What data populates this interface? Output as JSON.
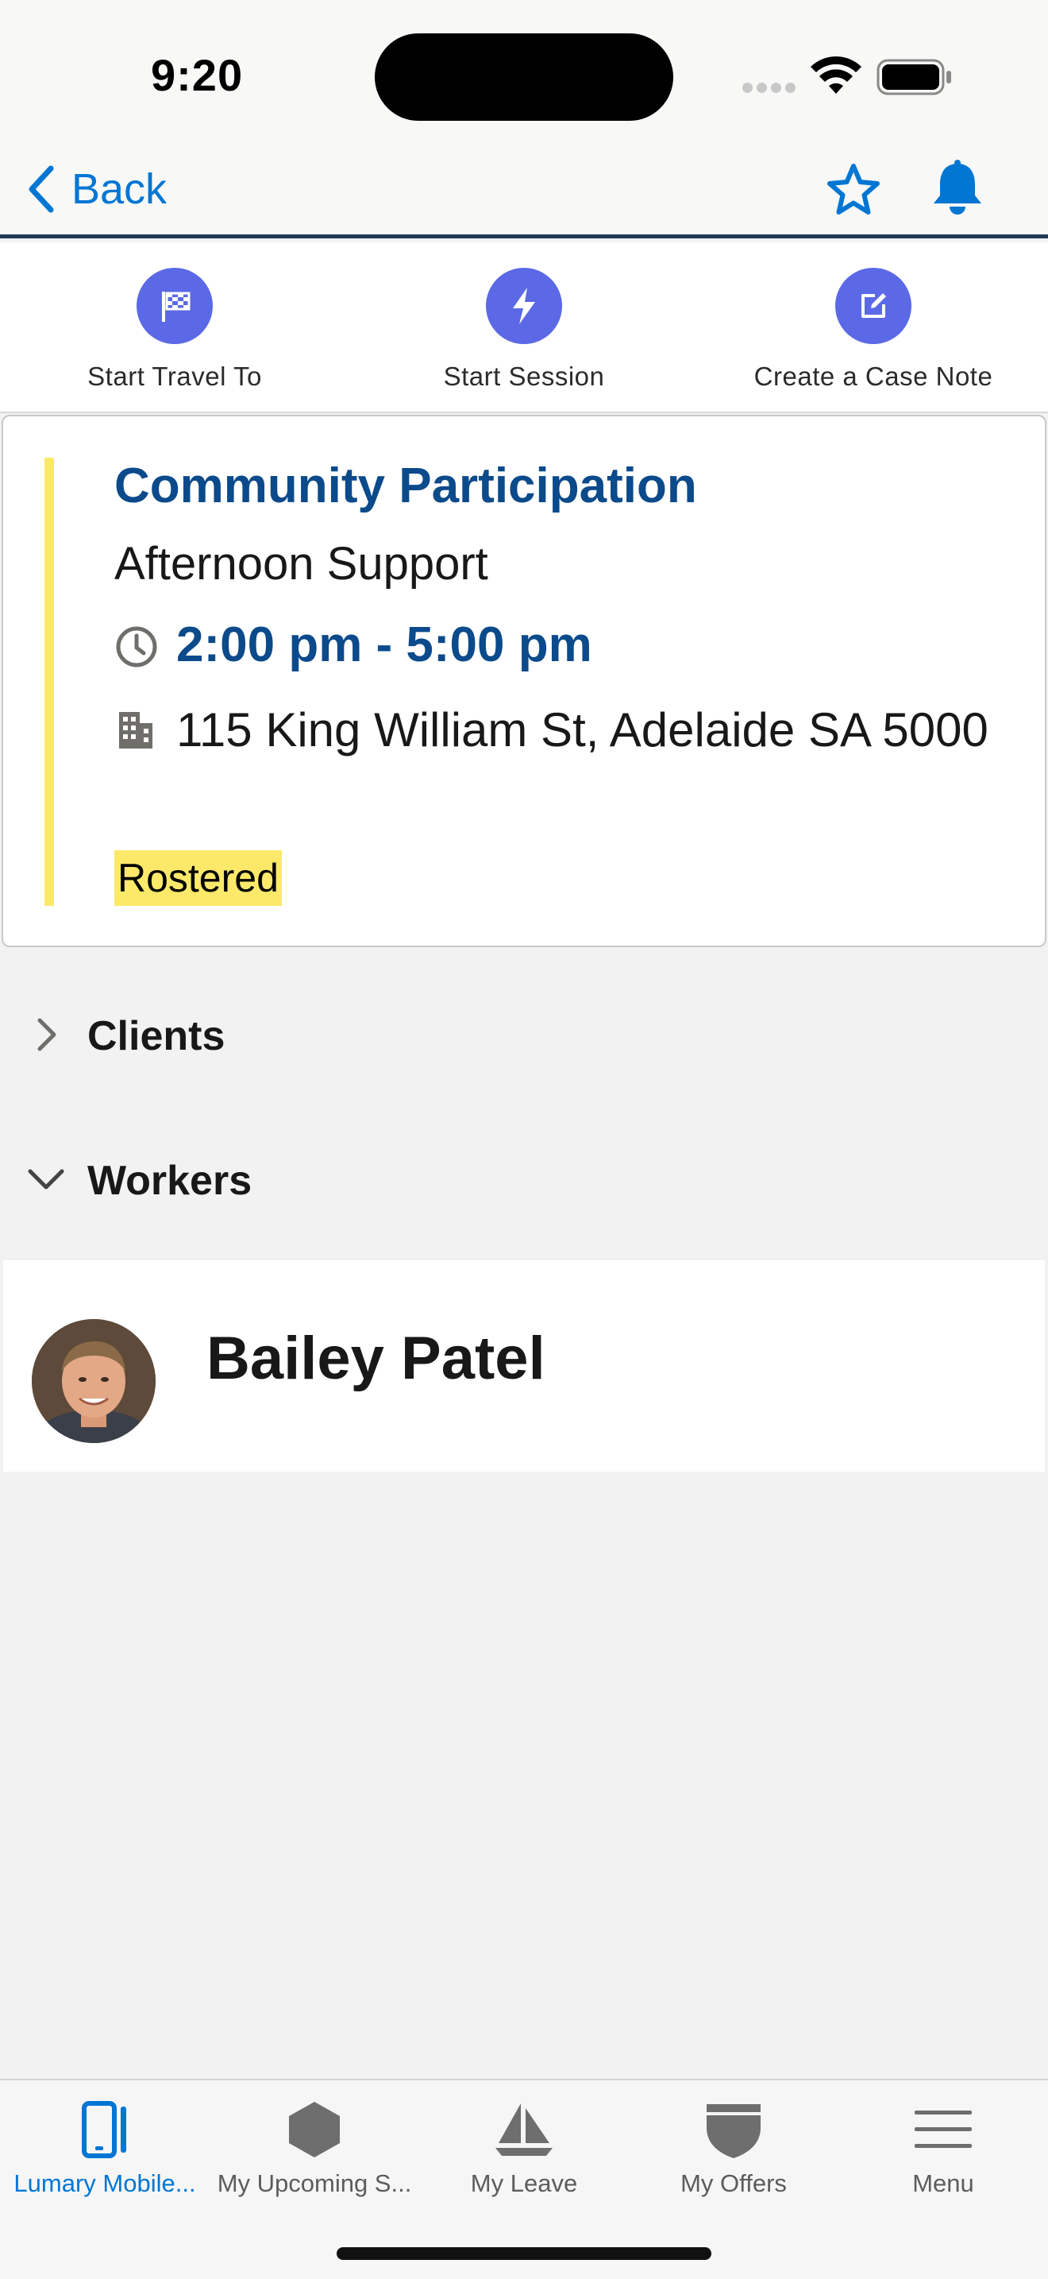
{
  "status_bar": {
    "time": "9:20"
  },
  "nav": {
    "back_label": "Back"
  },
  "actions": [
    {
      "label": "Start Travel To",
      "icon": "checkered-flag-icon"
    },
    {
      "label": "Start Session",
      "icon": "lightning-icon"
    },
    {
      "label": "Create a Case Note",
      "icon": "edit-note-icon"
    }
  ],
  "card": {
    "title": "Community Participation",
    "subtitle": "Afternoon Support",
    "time": "2:00 pm - 5:00 pm",
    "address": "115 King William St, Adelaide SA 5000",
    "status": "Rostered"
  },
  "sections": {
    "clients": "Clients",
    "workers": "Workers"
  },
  "worker": {
    "name": "Bailey Patel"
  },
  "tabs": [
    {
      "label": "Lumary Mobile...",
      "icon": "phone-icon",
      "active": true
    },
    {
      "label": "My Upcoming S...",
      "icon": "hexagon-icon",
      "active": false
    },
    {
      "label": "My Leave",
      "icon": "sailboat-icon",
      "active": false
    },
    {
      "label": "My Offers",
      "icon": "shield-icon",
      "active": false
    },
    {
      "label": "Menu",
      "icon": "hamburger-icon",
      "active": false
    }
  ],
  "colors": {
    "accent": "#0176d3",
    "title_blue": "#0b4a8b",
    "action_circle": "#5b69e6",
    "status_yellow": "#fce96a",
    "header_rule": "#203a52"
  }
}
